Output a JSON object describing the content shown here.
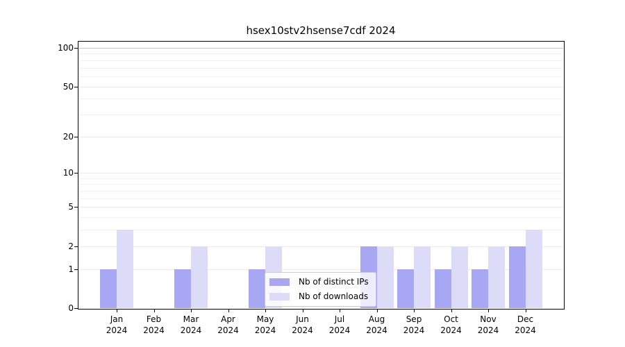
{
  "chart_data": {
    "type": "bar",
    "title": "hsex10stv2hsense7cdf 2024",
    "categories": [
      "Jan",
      "Feb",
      "Mar",
      "Apr",
      "May",
      "Jun",
      "Jul",
      "Aug",
      "Sep",
      "Oct",
      "Nov",
      "Dec"
    ],
    "category_year_label": "2024",
    "series": [
      {
        "name": "Nb of distinct IPs",
        "color": "#a7a7f3",
        "values": [
          1,
          0,
          1,
          0,
          1,
          0,
          0,
          2,
          1,
          1,
          1,
          2
        ]
      },
      {
        "name": "Nb of downloads",
        "color": "#dcdcf8",
        "values": [
          3,
          0,
          2,
          0,
          2,
          0,
          0,
          2,
          2,
          2,
          2,
          3
        ]
      }
    ],
    "y_axis": {
      "scale": "log1p",
      "tick_values": [
        0,
        1,
        2,
        5,
        10,
        20,
        50,
        100
      ],
      "tick_labels": [
        "0",
        "1",
        "2",
        "5",
        "10",
        "20",
        "50",
        "100"
      ],
      "minor_grid_values": [
        3,
        4,
        6,
        7,
        8,
        9,
        30,
        40,
        60,
        70,
        80,
        90
      ],
      "range": [
        0,
        112
      ]
    },
    "x_axis": {
      "label_line2": "2024"
    },
    "grid": "on",
    "legend": {
      "position": "inside-lower-center"
    },
    "colors": {
      "background": "#ffffff",
      "frame": "#000000",
      "grid_minor": "#f2f2f2",
      "grid_major": "#ececec",
      "grid_top_100": "#c8c8c8",
      "bar_distinct_ips": "#a7a7f3",
      "bar_downloads": "#dcdcf8"
    }
  }
}
